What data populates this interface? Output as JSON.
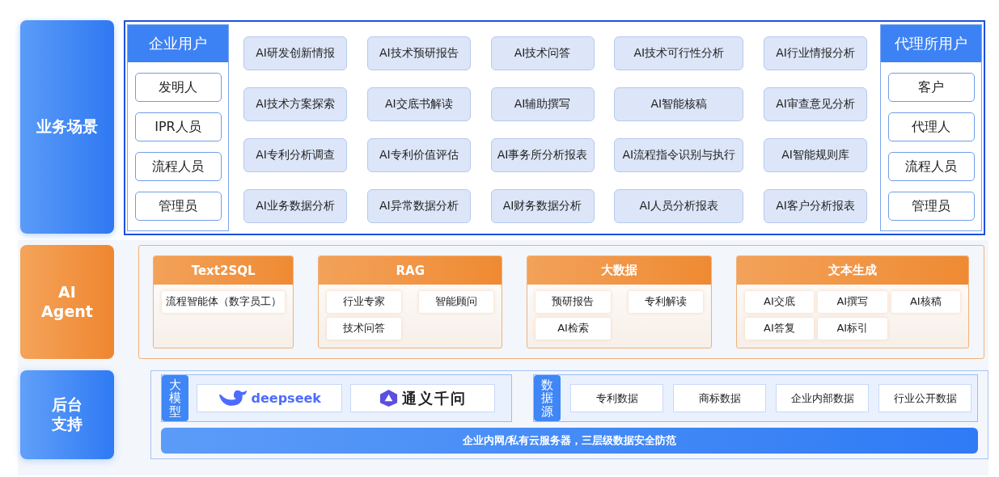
{
  "business": {
    "label": "业务场景",
    "enterprise": {
      "title": "企业用户",
      "roles": [
        "发明人",
        "IPR人员",
        "流程人员",
        "管理员"
      ]
    },
    "functions": [
      "AI研发创新情报",
      "AI技术预研报告",
      "AI技术问答",
      "AI技术可行性分析",
      "AI行业情报分析",
      "AI技术方案探索",
      "AI交底书解读",
      "AI辅助撰写",
      "AI智能核稿",
      "AI审查意见分析",
      "AI专利分析调查",
      "AI专利价值评估",
      "AI事务所分析报表",
      "AI流程指令识别与执行",
      "AI智能规则库",
      "AI业务数据分析",
      "AI异常数据分析",
      "AI财务数据分析",
      "AI人员分析报表",
      "AI客户分析报表"
    ],
    "agency": {
      "title": "代理所用户",
      "roles": [
        "客户",
        "代理人",
        "流程人员",
        "管理员"
      ]
    }
  },
  "agent": {
    "label": "AI\nAgent",
    "groups": [
      {
        "title": "Text2SQL",
        "items": [
          "流程智能体（数字员工）"
        ]
      },
      {
        "title": "RAG",
        "items": [
          "行业专家",
          "智能顾问",
          "技术问答"
        ]
      },
      {
        "title": "大数据",
        "items": [
          "预研报告",
          "专利解读",
          "AI检索"
        ]
      },
      {
        "title": "文本生成",
        "items": [
          "AI交底",
          "AI撰写",
          "AI核稿",
          "AI答复",
          "AI标引"
        ]
      }
    ]
  },
  "backend": {
    "label": "后台支持",
    "models": {
      "label": "大模型",
      "items": [
        {
          "kind": "deepseek",
          "name": "deepseek"
        },
        {
          "kind": "tongyi",
          "name": "通义千问"
        }
      ]
    },
    "sources": {
      "label": "数据源",
      "items": [
        "专利数据",
        "商标数据",
        "企业内部数据",
        "行业公开数据"
      ]
    },
    "footer": "企业内网/私有云服务器，三层级数据安全防范"
  }
}
